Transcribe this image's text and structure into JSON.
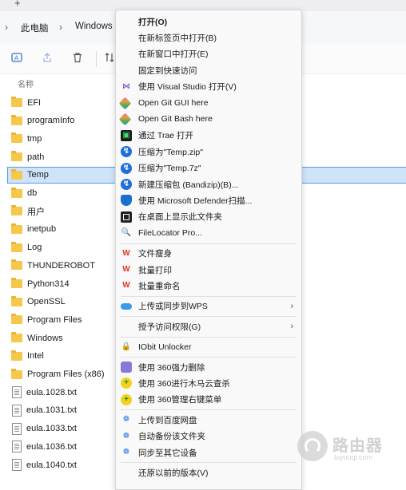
{
  "window": {
    "newtab_glyph": "+",
    "breadcrumb": [
      "此电脑",
      "Windows"
    ],
    "chevron": "›",
    "toolbar_icons": [
      "ai-rename-icon",
      "share-icon",
      "delete-icon",
      "sort-icon"
    ]
  },
  "list": {
    "column_header": "名称",
    "items": [
      {
        "name": "EFI",
        "type": "folder"
      },
      {
        "name": "programInfo",
        "type": "folder"
      },
      {
        "name": "tmp",
        "type": "folder"
      },
      {
        "name": "path",
        "type": "folder"
      },
      {
        "name": "Temp",
        "type": "folder",
        "selected": true
      },
      {
        "name": "db",
        "type": "folder"
      },
      {
        "name": "用户",
        "type": "folder"
      },
      {
        "name": "inetpub",
        "type": "folder"
      },
      {
        "name": "Log",
        "type": "folder"
      },
      {
        "name": "THUNDEROBOT",
        "type": "folder"
      },
      {
        "name": "Python314",
        "type": "folder"
      },
      {
        "name": "OpenSSL",
        "type": "folder"
      },
      {
        "name": "Program Files",
        "type": "folder"
      },
      {
        "name": "Windows",
        "type": "folder"
      },
      {
        "name": "Intel",
        "type": "folder"
      },
      {
        "name": "Program Files (x86)",
        "type": "folder"
      },
      {
        "name": "eula.1028.txt",
        "type": "file"
      },
      {
        "name": "eula.1031.txt",
        "type": "file"
      },
      {
        "name": "eula.1033.txt",
        "type": "file"
      },
      {
        "name": "eula.1036.txt",
        "type": "file"
      },
      {
        "name": "eula.1040.txt",
        "type": "file"
      }
    ]
  },
  "context_menu": {
    "items": [
      {
        "label": "打开(O)",
        "bold": true,
        "icon": "none"
      },
      {
        "label": "在新标签页中打开(B)",
        "icon": "none"
      },
      {
        "label": "在新窗口中打开(E)",
        "icon": "none"
      },
      {
        "label": "固定到快速访问",
        "icon": "none"
      },
      {
        "label": "使用 Visual Studio 打开(V)",
        "icon": "visual-studio-icon"
      },
      {
        "label": "Open Git GUI here",
        "icon": "git-gui-icon"
      },
      {
        "label": "Open Git Bash here",
        "icon": "git-bash-icon"
      },
      {
        "label": "通过 Trae 打开",
        "icon": "trae-icon"
      },
      {
        "label": "压缩为\"Temp.zip\"",
        "icon": "bandizip-icon"
      },
      {
        "label": "压缩为\"Temp.7z\"",
        "icon": "bandizip-icon"
      },
      {
        "label": "新建压缩包 (Bandizip)(B)...",
        "icon": "bandizip-icon"
      },
      {
        "label": "使用 Microsoft Defender扫描...",
        "icon": "defender-shield-icon"
      },
      {
        "label": "在桌面上显示此文件夹",
        "icon": "desktop-icon"
      },
      {
        "label": "FileLocator Pro...",
        "icon": "search-icon"
      },
      {
        "sep": true
      },
      {
        "label": "文件瘦身",
        "icon": "wps-icon"
      },
      {
        "label": "批量打印",
        "icon": "wps-icon"
      },
      {
        "label": "批量重命名",
        "icon": "wps-icon"
      },
      {
        "sep": true
      },
      {
        "label": "上传或同步到WPS",
        "icon": "wps-cloud-icon",
        "submenu": true
      },
      {
        "sep": true
      },
      {
        "label": "授予访问权限(G)",
        "icon": "none",
        "submenu": true
      },
      {
        "sep": true
      },
      {
        "label": "IObit Unlocker",
        "icon": "lock-icon"
      },
      {
        "sep": true
      },
      {
        "label": "使用 360强力删除",
        "icon": "360-delete-icon"
      },
      {
        "label": "使用 360进行木马云查杀",
        "icon": "360-scan-icon"
      },
      {
        "label": "使用 360管理右键菜单",
        "icon": "360-menu-icon"
      },
      {
        "sep": true
      },
      {
        "label": "上传到百度网盘",
        "icon": "baidu-netdisk-icon"
      },
      {
        "label": "自动备份该文件夹",
        "icon": "baidu-netdisk-icon"
      },
      {
        "label": "同步至其它设备",
        "icon": "baidu-netdisk-icon"
      },
      {
        "sep": true
      },
      {
        "label": "还原以前的版本(V)",
        "icon": "none"
      }
    ],
    "submenu_arrow": "›"
  },
  "watermark": {
    "text": "路由器",
    "sub": "luyouqi.com"
  }
}
